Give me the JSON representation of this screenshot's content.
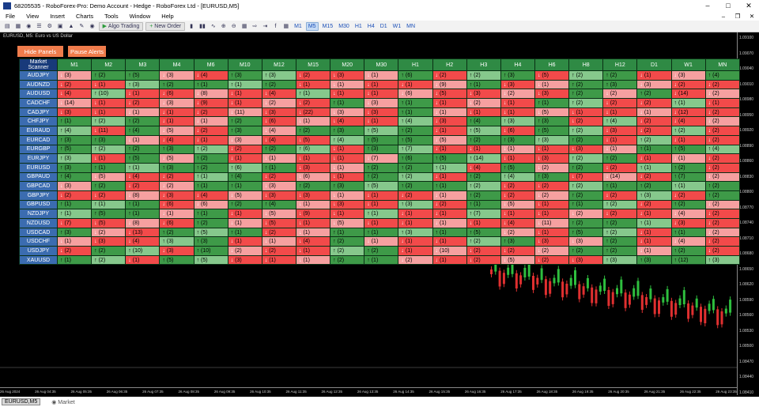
{
  "window": {
    "account_id": "68205535",
    "title": "68205535 - RoboForex-Pro: Demo Account - Hedge - RoboForex Ltd - [EURUSD,M5]"
  },
  "menu": [
    "File",
    "View",
    "Insert",
    "Charts",
    "Tools",
    "Window",
    "Help"
  ],
  "toolbar": {
    "algo_trading": "Algo Trading",
    "new_order": "New Order",
    "timeframes": [
      "M1",
      "M5",
      "M15",
      "M30",
      "H1",
      "H4",
      "D1",
      "W1",
      "MN"
    ],
    "active_timeframe": "M5"
  },
  "chart": {
    "label": "EURUSD, M5: Euro vs US Dollar"
  },
  "buttons": {
    "hide_panels": "Hide Panels",
    "pause_alerts": "Pause Alerts"
  },
  "scanner": {
    "corner": "Market Scanner",
    "columns": [
      "M1",
      "M2",
      "M3",
      "M4",
      "M6",
      "M10",
      "M12",
      "M15",
      "M20",
      "M30",
      "H1",
      "H2",
      "H3",
      "H4",
      "H6",
      "H8",
      "H12",
      "D1",
      "W1",
      "MN"
    ],
    "rows": [
      {
        "pair": "AUDJPY",
        "cells": [
          "d3",
          "u2",
          "u5",
          "d3",
          "d4",
          "u3",
          "u3",
          "d2",
          "d3",
          "d1",
          "u6",
          "d2",
          "u2",
          "u3",
          "d5",
          "u2",
          "u2",
          "d1",
          "d3",
          "u4"
        ]
      },
      {
        "pair": "AUDNZD",
        "cells": [
          "d2",
          "d1",
          "u3",
          "u2",
          "u1",
          "u1",
          "u2",
          "d1",
          "d1",
          "d1",
          "d1",
          "d9",
          "u1",
          "d3",
          "d1",
          "u2",
          "u3",
          "d3",
          "d2",
          "d2"
        ]
      },
      {
        "pair": "AUDUSD",
        "cells": [
          "d4",
          "u10",
          "d1",
          "d6",
          "d8",
          "d1",
          "d4",
          "u1",
          "d1",
          "d1",
          "d6",
          "d5",
          "d3",
          "d2",
          "d3",
          "u2",
          "d2",
          "u2",
          "d14",
          "d2"
        ]
      },
      {
        "pair": "CADCHF",
        "cells": [
          "d14",
          "d1",
          "d2",
          "d3",
          "d9",
          "d1",
          "d2",
          "d2",
          "u1",
          "d3",
          "u1",
          "d1",
          "d2",
          "d1",
          "u1",
          "u2",
          "d2",
          "d2",
          "u1",
          "d1"
        ]
      },
      {
        "pair": "CADJPY",
        "cells": [
          "d3",
          "d1",
          "d1",
          "d1",
          "d2",
          "d11",
          "d3",
          "d22",
          "d3",
          "d3",
          "u1",
          "d1",
          "d1",
          "d1",
          "d5",
          "d1",
          "d1",
          "d1",
          "d12",
          "d2"
        ]
      },
      {
        "pair": "CHFJPY",
        "cells": [
          "u1",
          "u2",
          "u2",
          "d1",
          "d1",
          "u2",
          "d6",
          "d1",
          "d4",
          "d1",
          "u4",
          "d3",
          "u4",
          "u3",
          "u3",
          "d2",
          "u4",
          "d2",
          "d4",
          "d2"
        ]
      },
      {
        "pair": "EURAUD",
        "cells": [
          "u4",
          "d11",
          "u4",
          "d5",
          "d2",
          "u3",
          "d4",
          "u2",
          "u3",
          "u5",
          "u2",
          "d1",
          "u5",
          "d6",
          "u5",
          "u2",
          "d3",
          "d2",
          "u2",
          "d2"
        ]
      },
      {
        "pair": "EURCAD",
        "cells": [
          "u3",
          "u3",
          "d1",
          "d4",
          "d1",
          "d3",
          "d4",
          "d5",
          "u4",
          "u5",
          "u5",
          "d5",
          "u2",
          "u3",
          "u3",
          "u2",
          "d1",
          "u2",
          "d1",
          "d2"
        ]
      },
      {
        "pair": "EURGBP",
        "cells": [
          "u5",
          "u2",
          "u2",
          "u3",
          "u2",
          "d2",
          "u2",
          "u6",
          "d1",
          "u3",
          "u7",
          "d1",
          "d1",
          "d1",
          "d1",
          "d3",
          "d1",
          "u1",
          "u5",
          "u4"
        ]
      },
      {
        "pair": "EURJPY",
        "cells": [
          "u3",
          "d1",
          "u5",
          "d5",
          "u2",
          "d1",
          "d1",
          "d1",
          "d1",
          "d7",
          "u6",
          "u5",
          "u14",
          "d1",
          "d3",
          "u2",
          "u2",
          "d1",
          "d1",
          "d2"
        ]
      },
      {
        "pair": "EURUSD",
        "cells": [
          "u3",
          "u1",
          "u1",
          "u3",
          "u2",
          "u6",
          "u1",
          "d3",
          "d1",
          "u2",
          "u2",
          "u1",
          "d4",
          "u5",
          "d2",
          "u2",
          "d2",
          "u1",
          "u2",
          "d2"
        ]
      },
      {
        "pair": "GBPAUD",
        "cells": [
          "u4",
          "d5",
          "d4",
          "d2",
          "u1",
          "u4",
          "d2",
          "d6",
          "d1",
          "u2",
          "u2",
          "d1",
          "u2",
          "u4",
          "u3",
          "d7",
          "d14",
          "d2",
          "u7",
          "d2"
        ]
      },
      {
        "pair": "GBPCAD",
        "cells": [
          "d3",
          "u2",
          "d2",
          "d2",
          "u1",
          "u1",
          "d3",
          "u2",
          "u3",
          "u5",
          "u2",
          "u1",
          "u2",
          "d2",
          "d2",
          "u2",
          "u1",
          "u2",
          "u1",
          "u2"
        ]
      },
      {
        "pair": "GBPJPY",
        "cells": [
          "d2",
          "d2",
          "d8",
          "d3",
          "d4",
          "d5",
          "d3",
          "d3",
          "d1",
          "d1",
          "d2",
          "d1",
          "u2",
          "d2",
          "d2",
          "u2",
          "d2",
          "u3",
          "d2",
          "u2"
        ]
      },
      {
        "pair": "GBPUSD",
        "cells": [
          "u1",
          "u1",
          "u1",
          "d6",
          "d6",
          "u2",
          "u4",
          "d1",
          "d3",
          "d1",
          "u3",
          "d2",
          "u1",
          "d5",
          "d1",
          "u1",
          "u2",
          "d2",
          "u2",
          "d2"
        ]
      },
      {
        "pair": "NZDJPY",
        "cells": [
          "u1",
          "u5",
          "u1",
          "d1",
          "u1",
          "d1",
          "d5",
          "d9",
          "d1",
          "u1",
          "d1",
          "d1",
          "u7",
          "d1",
          "d1",
          "d2",
          "d2",
          "d1",
          "d4",
          "d2"
        ]
      },
      {
        "pair": "NZDUSD",
        "cells": [
          "d7",
          "d5",
          "d8",
          "d6",
          "u2",
          "d1",
          "d5",
          "d1",
          "d5",
          "d1",
          "d1",
          "d1",
          "d1",
          "d4",
          "d11",
          "u2",
          "u2",
          "u1",
          "d3",
          "d2"
        ]
      },
      {
        "pair": "USDCAD",
        "cells": [
          "u3",
          "d2",
          "d13",
          "u2",
          "u5",
          "u1",
          "d2",
          "d1",
          "u1",
          "u1",
          "u3",
          "u1",
          "u5",
          "d2",
          "d1",
          "u5",
          "u2",
          "d1",
          "u1",
          "d2"
        ]
      },
      {
        "pair": "USDCHF",
        "cells": [
          "d1",
          "d3",
          "d4",
          "u3",
          "u3",
          "d1",
          "d1",
          "d4",
          "u2",
          "d1",
          "d1",
          "d1",
          "u2",
          "u3",
          "d3",
          "d3",
          "u2",
          "d1",
          "d4",
          "d2"
        ]
      },
      {
        "pair": "USDJPY",
        "cells": [
          "d2",
          "u2",
          "u10",
          "d3",
          "u10",
          "d2",
          "d2",
          "d1",
          "u2",
          "u2",
          "d1",
          "d10",
          "d2",
          "d2",
          "d2",
          "u2",
          "u2",
          "d1",
          "u2",
          "d2"
        ]
      },
      {
        "pair": "XAUUSD",
        "cells": [
          "u1",
          "u2",
          "d1",
          "u5",
          "u5",
          "d3",
          "d1",
          "d1",
          "u2",
          "u1",
          "d2",
          "d1",
          "d2",
          "d5",
          "d2",
          "d3",
          "u3",
          "u3",
          "u12",
          "u3"
        ]
      }
    ]
  },
  "price_axis": [
    "1.09100",
    "1.09070",
    "1.09040",
    "1.09010",
    "1.08980",
    "1.08950",
    "1.08920",
    "1.08890",
    "1.08860",
    "1.08830",
    "1.08800",
    "1.08770",
    "1.08740",
    "1.08710",
    "1.08680",
    "1.08650",
    "1.08620",
    "1.08590",
    "1.08560",
    "1.08530",
    "1.08500",
    "1.08470",
    "1.08440",
    "1.08410"
  ],
  "time_axis": [
    "26 Aug 2024",
    "26 Aug 04:35",
    "26 Aug 05:35",
    "26 Aug 06:35",
    "26 Aug 07:35",
    "26 Aug 08:35",
    "26 Aug 09:35",
    "26 Aug 10:35",
    "26 Aug 11:35",
    "26 Aug 12:35",
    "26 Aug 13:35",
    "26 Aug 14:35",
    "26 Aug 15:35",
    "26 Aug 16:35",
    "26 Aug 17:35",
    "26 Aug 18:35",
    "26 Aug 19:35",
    "26 Aug 20:35",
    "26 Aug 21:35",
    "26 Aug 22:35",
    "26 Aug 23:35"
  ],
  "tabs": {
    "symbol": "EURUSD,M5",
    "market": "Market"
  },
  "colors": {
    "up_strong": "#3e9a48",
    "up_light": "#86c88c",
    "down_strong": "#f24a4a",
    "down_light": "#f6a0a0",
    "neutral": "#8a8a8a"
  }
}
